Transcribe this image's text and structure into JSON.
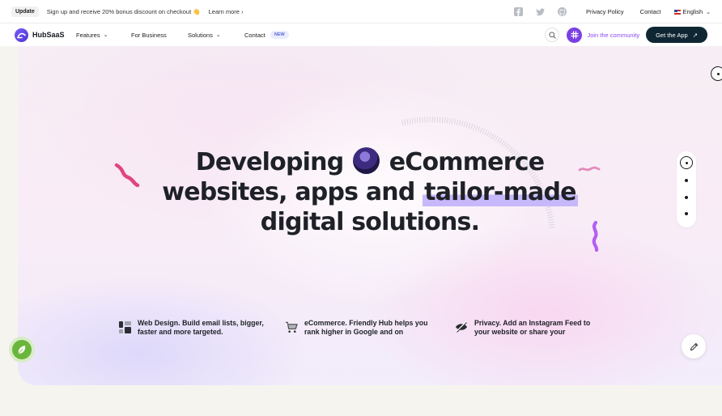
{
  "topbar": {
    "badge": "Update",
    "promo": "Sign up and receive 20% bonus discount on checkout 👋",
    "learn_more": "Learn more",
    "links": [
      "Privacy Policy",
      "Contact"
    ],
    "language": "English"
  },
  "nav": {
    "brand": "HubSaaS",
    "items": [
      {
        "label": "Features",
        "dropdown": true
      },
      {
        "label": "For Business",
        "dropdown": false
      },
      {
        "label": "Solutions",
        "dropdown": true
      },
      {
        "label": "Contact",
        "dropdown": false
      }
    ],
    "new_badge": "NEW",
    "join": "Join the community",
    "cta": "Get the App"
  },
  "hero": {
    "line1_a": "Developing",
    "line1_b": "eCommerce",
    "line2_a": "websites, apps and",
    "line2_b": "tailor-made",
    "line3": "digital solutions."
  },
  "features": [
    {
      "icon": "layout-icon",
      "text1": "Web Design. Build email lists, bigger,",
      "text2": "faster and more targeted."
    },
    {
      "icon": "cart-icon",
      "text1": "eCommerce. Friendly Hub helps you",
      "text2": "rank higher in Google and on"
    },
    {
      "icon": "privacy-icon",
      "text1": "Privacy. Add an Instagram Feed to",
      "text2": "your website or share your"
    }
  ],
  "colors": {
    "accent_purple": "#8a4bf0",
    "cta_dark": "#0f2733",
    "highlight": "#c7b8fb",
    "squiggle_pink": "#e0457f",
    "squiggle_violet": "#b45ff0"
  }
}
